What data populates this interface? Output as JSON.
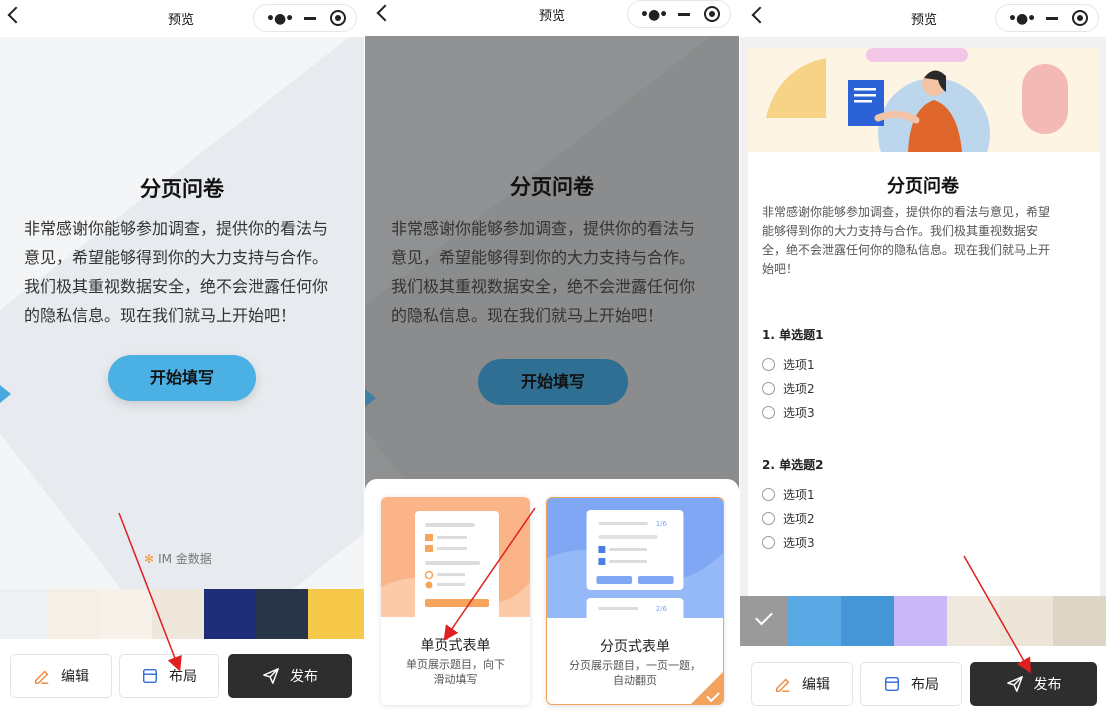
{
  "topbar": {
    "title": "预览"
  },
  "cover": {
    "title": "分页问卷",
    "text_lines": [
      "非常感谢你能够参加调查，提供你的看法与",
      "意见，希望能够得到你的大力支持与合作。",
      "我们极其重视数据安全，绝不会泄露任何你",
      "的隐私信息。现在我们就马上开始吧！"
    ],
    "start_button": "开始填写",
    "brand": "IM 金数据"
  },
  "toolbar": {
    "edit": "编辑",
    "layout": "布局",
    "publish": "发布"
  },
  "layout_sheet": {
    "options": [
      {
        "title": "单页式表单",
        "desc_lines": [
          "单页展示题目，向下",
          "滑动填写"
        ]
      },
      {
        "title": "分页式表单",
        "desc_lines": [
          "分页展示题目，一页一题，",
          "自动翻页"
        ],
        "page_labels": [
          "1/6",
          "2/6"
        ]
      }
    ]
  },
  "survey": {
    "title": "分页问卷",
    "desc_lines": [
      "非常感谢你能够参加调查，提供你的看法与意见，希望",
      "能够得到你的大力支持与合作。我们极其重视数据安",
      "全，绝不会泄露任何你的隐私信息。现在我们就马上开",
      "始吧！"
    ],
    "questions": [
      {
        "label": "1. 单选题1",
        "options": [
          "选项1",
          "选项2",
          "选项3"
        ]
      },
      {
        "label": "2. 单选题2",
        "options": [
          "选项1",
          "选项2",
          "选项3"
        ]
      }
    ]
  },
  "swatches_p1": [
    "#eef1f4",
    "#f5efe6",
    "#f7f1ea",
    "#efe6dc",
    "#1f2c78",
    "#283549",
    "#f7c94a"
  ],
  "swatches_p3": [
    "#9a9a9a",
    "#5aa8e4",
    "#4496d6",
    "#c9b8f7",
    "#efe8de",
    "#ede6d8",
    "#ddd6c6"
  ],
  "colors": {
    "accent_blue": "#4bb0e4",
    "dark_button": "#2e2e2e",
    "select_orange": "#f3a25d"
  }
}
